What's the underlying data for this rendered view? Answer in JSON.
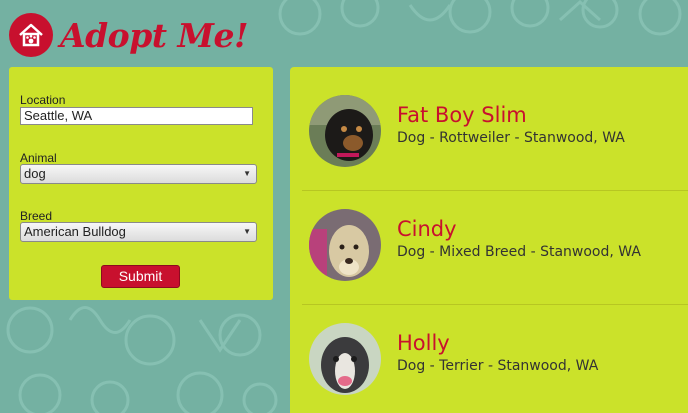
{
  "header": {
    "logo_text": "Adopt Me!"
  },
  "search": {
    "location_label": "Location",
    "location_value": "Seattle, WA",
    "animal_label": "Animal",
    "animal_value": "dog",
    "breed_label": "Breed",
    "breed_value": "American Bulldog",
    "submit_label": "Submit"
  },
  "pets": [
    {
      "name": "Fat Boy Slim",
      "info": "Dog - Rottweiler - Stanwood, WA"
    },
    {
      "name": "Cindy",
      "info": "Dog - Mixed Breed - Stanwood, WA"
    },
    {
      "name": "Holly",
      "info": "Dog - Terrier - Stanwood, WA"
    }
  ],
  "colors": {
    "brand": "#c8102e",
    "panel": "#cbe22a",
    "background": "#74b1a2"
  }
}
